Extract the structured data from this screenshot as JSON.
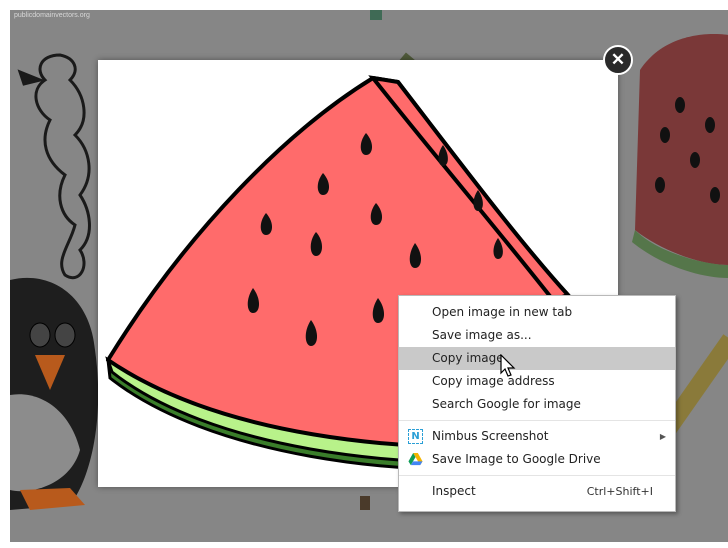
{
  "background": {
    "site_text": "publicdomainvectors.org"
  },
  "lightbox": {
    "close_glyph": "✕"
  },
  "context_menu": {
    "items": [
      {
        "label": "Open image in new tab"
      },
      {
        "label": "Save image as..."
      },
      {
        "label": "Copy image"
      },
      {
        "label": "Copy image address"
      },
      {
        "label": "Search Google for image"
      },
      {
        "label": "Nimbus Screenshot",
        "icon": "nimbus-n-icon",
        "submenu_arrow": "▶"
      },
      {
        "label": "Save Image to Google Drive",
        "icon": "google-drive-icon"
      },
      {
        "label": "Inspect",
        "shortcut": "Ctrl+Shift+I"
      }
    ]
  },
  "colors": {
    "overlay": "#868686",
    "highlight": "#c9c9c9",
    "watermelon_flesh": "#ff6b6b",
    "watermelon_rind_light": "#b8f28a",
    "watermelon_rind_dark": "#3a7d2a"
  }
}
